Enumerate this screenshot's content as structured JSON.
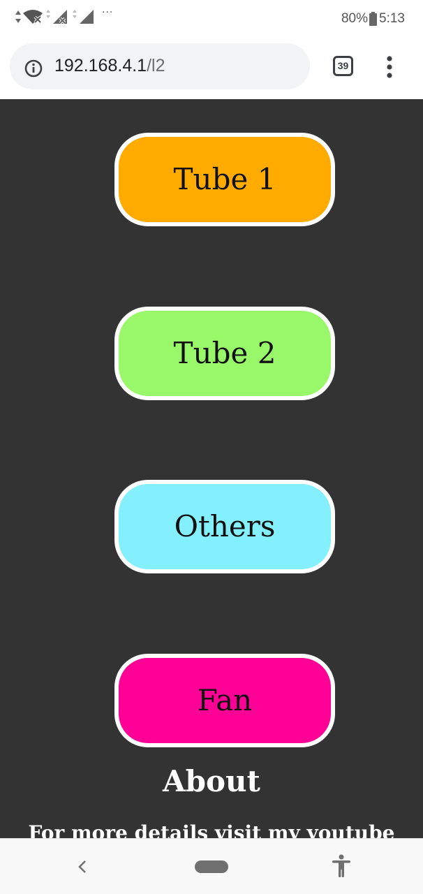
{
  "status_bar": {
    "battery_percent": "80%",
    "time": "5:13",
    "overflow": "···",
    "icons": [
      "data-arrows-icon",
      "wifi-off-icon",
      "signal-no-sim-icon",
      "signal-icon",
      "battery-icon"
    ]
  },
  "browser": {
    "url_host": "192.168.4.1",
    "url_path": "/l2",
    "tab_count": "39",
    "icons": [
      "info-icon",
      "more-vert-icon"
    ]
  },
  "page": {
    "background": "#333333",
    "buttons": [
      {
        "label": "Tube 1",
        "color": "#ffab00"
      },
      {
        "label": "Tube 2",
        "color": "#99f86a"
      },
      {
        "label": "Others",
        "color": "#84effd"
      },
      {
        "label": "Fan",
        "color": "#ff0097"
      }
    ],
    "about_title": "About",
    "about_text": "For more details visit my youtube"
  },
  "nav_bar": {
    "icons": [
      "back-icon",
      "home-pill",
      "accessibility-icon"
    ]
  }
}
